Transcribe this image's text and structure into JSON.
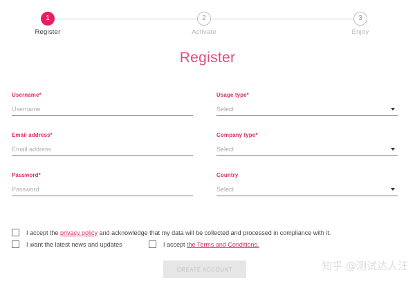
{
  "stepper": {
    "steps": [
      {
        "number": "1",
        "label": "Register"
      },
      {
        "number": "2",
        "label": "Activate"
      },
      {
        "number": "3",
        "label": "Enjoy"
      }
    ],
    "active_step": 1
  },
  "title": "Register",
  "fields": {
    "username": {
      "label": "Username*",
      "placeholder": "Username",
      "value": ""
    },
    "email": {
      "label": "Email address*",
      "placeholder": "Email address",
      "value": ""
    },
    "password": {
      "label": "Password*",
      "placeholder": "Password",
      "value": ""
    },
    "usage_type": {
      "label": "Usage type*",
      "selected": "Select"
    },
    "company_type": {
      "label": "Company type*",
      "selected": "Select"
    },
    "country": {
      "label": "Country",
      "selected": "Select"
    }
  },
  "checkboxes": {
    "privacy": {
      "text_before": "I accept the ",
      "link": "privacy policy",
      "text_after": " and acknowledge that my data will be collected and processed in compliance with it.",
      "checked": false
    },
    "news": {
      "text": "I want the latest news and updates",
      "checked": false
    },
    "terms": {
      "text_before": "I accept ",
      "link": "the Terms and Conditions.",
      "checked": false
    }
  },
  "submit_label": "CREATE ACCOUNT",
  "watermark": "知乎 @测试达人汪",
  "colors": {
    "accent": "#ea1b64",
    "label": "#d62f5e",
    "button_disabled_bg": "#e6e6e6"
  }
}
